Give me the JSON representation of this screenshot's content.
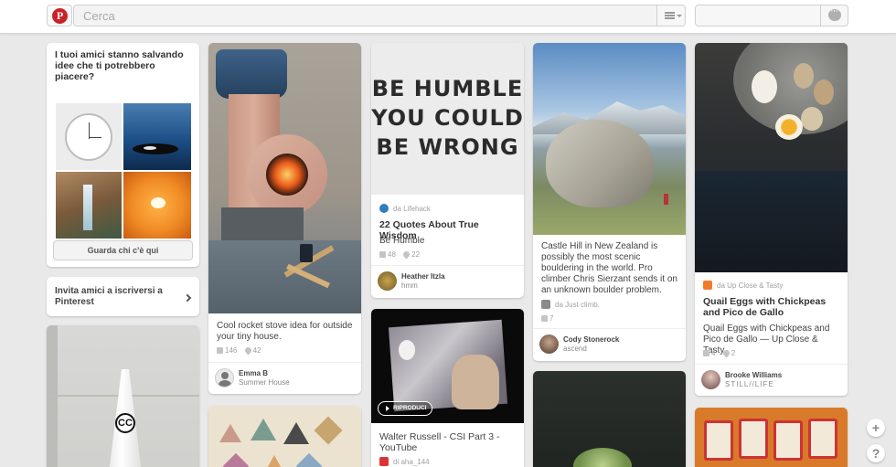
{
  "header": {
    "search_placeholder": "Cerca",
    "logo_letter": "P"
  },
  "col1": {
    "friends_title": "I tuoi amici stanno salvando idee che ti potrebbero piacere?",
    "friends_button": "Guarda chi c'è qui",
    "invite_text": "Invita amici a iscriversi a Pinterest"
  },
  "pins": {
    "rocket": {
      "desc": "Cool rocket stove idea for outside your tiny house.",
      "repins": "146",
      "likes": "42",
      "pinner": "Emma B",
      "board": "Summer House"
    },
    "humble": {
      "poster_line1": "BE HUMBLE",
      "poster_line2": "YOU COULD",
      "poster_line3": "BE WRONG",
      "source": "da Lifehack",
      "title": "22 Quotes About True Wisdom",
      "desc": "Be Humble",
      "repins": "48",
      "likes": "22",
      "pinner": "Heather Itzla",
      "board": "hmm"
    },
    "video": {
      "play_label": "RIPRODUCI",
      "title": "Walter Russell - CSI Part 3 - YouTube",
      "source": "di aha_144"
    },
    "castle": {
      "desc": "Castle Hill in New Zealand is possibly the most scenic bouldering in the world. Pro climber Chris Sierzant sends it on an unknown boulder problem.",
      "source": "da Just climb.",
      "repins": "7",
      "pinner": "Cody Stonerock",
      "board": "ascend"
    },
    "quail": {
      "source": "da Up Close & Tasty",
      "title": "Quail Eggs with Chickpeas and Pico de Gallo",
      "desc": "Quail Eggs with Chickpeas and Pico de Gallo — Up Close & Tasty",
      "repins": "4",
      "likes": "2",
      "pinner": "Brooke Williams",
      "board": "STILL//LIFE"
    }
  },
  "fab": {
    "add": "+",
    "help": "?"
  },
  "colors": {
    "brand": "#cb2027",
    "background": "#e9e9e9"
  }
}
